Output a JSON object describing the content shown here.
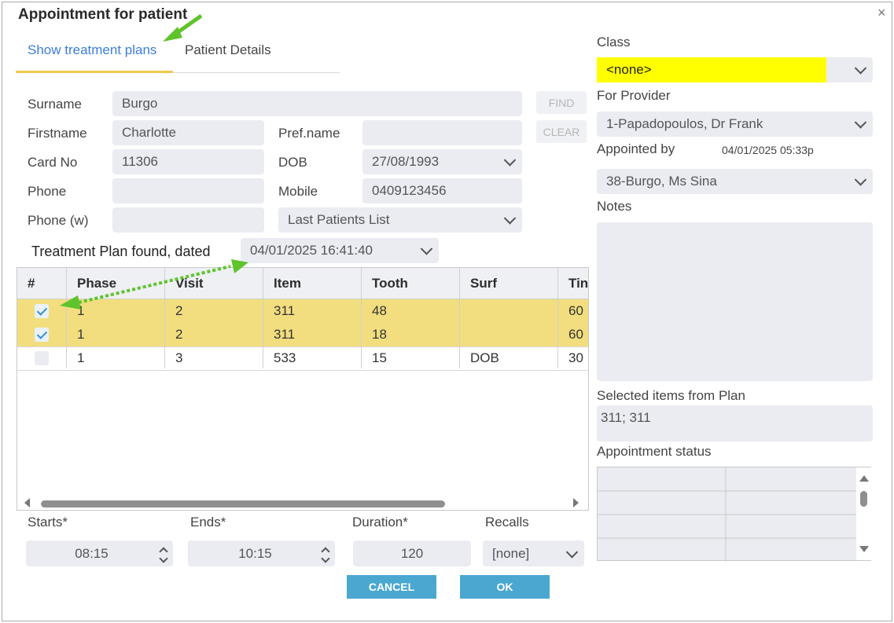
{
  "dialog": {
    "title": "Appointment for patient",
    "close": "×"
  },
  "tabs": {
    "treatment_plans": "Show treatment plans",
    "patient_details": "Patient Details"
  },
  "patient": {
    "surname_label": "Surname",
    "surname": "Burgo",
    "firstname_label": "Firstname",
    "firstname": "Charlotte",
    "prefname_label": "Pref.name",
    "prefname": "",
    "cardno_label": "Card No",
    "cardno": "11306",
    "dob_label": "DOB",
    "dob": "27/08/1993",
    "phone_label": "Phone",
    "phone": "",
    "mobile_label": "Mobile",
    "mobile": "0409123456",
    "phonew_label": "Phone (w)",
    "phonew": "",
    "patients_list": "Last Patients List",
    "find_label": "FIND",
    "clear_label": "CLEAR"
  },
  "plan": {
    "found_label": "Treatment Plan found, dated",
    "date": "04/01/2025 16:41:40"
  },
  "grid": {
    "headers": [
      "#",
      "Phase",
      "Visit",
      "Item",
      "Tooth",
      "Surf",
      "Tin"
    ],
    "rows": [
      {
        "checked": true,
        "phase": "1",
        "visit": "2",
        "item": "311",
        "tooth": "48",
        "surf": "",
        "time": "60"
      },
      {
        "checked": true,
        "phase": "1",
        "visit": "2",
        "item": "311",
        "tooth": "18",
        "surf": "",
        "time": "60"
      },
      {
        "checked": false,
        "phase": "1",
        "visit": "3",
        "item": "533",
        "tooth": "15",
        "surf": "DOB",
        "time": "30"
      }
    ]
  },
  "timing": {
    "starts_label": "Starts*",
    "starts": "08:15",
    "ends_label": "Ends*",
    "ends": "10:15",
    "duration_label": "Duration*",
    "duration": "120",
    "recalls_label": "Recalls",
    "recalls": "[none]"
  },
  "buttons": {
    "cancel": "CANCEL",
    "ok": "OK"
  },
  "right": {
    "class_label": "Class",
    "class_value": "<none>",
    "provider_label": "For Provider",
    "provider": "1-Papadopoulos, Dr Frank",
    "appointed_by_label": "Appointed by",
    "appointed_at": "04/01/2025 05:33p",
    "appointed_by": "38-Burgo, Ms Sina",
    "notes_label": "Notes",
    "notes": "",
    "selected_label": "Selected items from Plan",
    "selected": "311; 311",
    "status_label": "Appointment status"
  },
  "colors": {
    "accent": "#3b7ddd",
    "highlight_row": "#f2de7f",
    "class_highlight": "#ffff00",
    "button": "#4aa7d0",
    "arrow": "#5fc32c"
  }
}
